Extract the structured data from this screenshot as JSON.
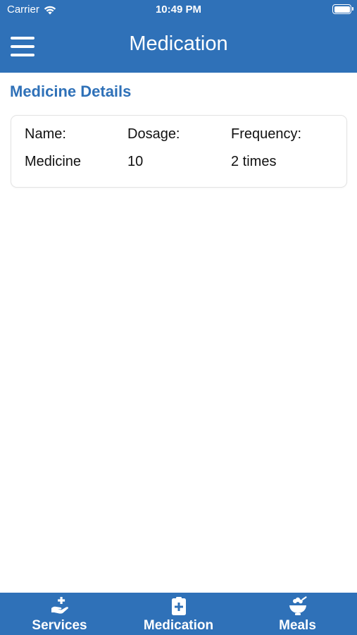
{
  "status_bar": {
    "carrier": "Carrier",
    "time": "10:49 PM"
  },
  "nav": {
    "title": "Medication",
    "menu_icon": "hamburger-menu-icon"
  },
  "section": {
    "title": "Medicine Details"
  },
  "medicine_card": {
    "columns": [
      {
        "header": "Name:",
        "value": "Medicine"
      },
      {
        "header": "Dosage:",
        "value": "10"
      },
      {
        "header": "Frequency:",
        "value": "2 times"
      }
    ]
  },
  "tab_bar": {
    "tabs": [
      {
        "label": "Services",
        "icon": "hand-holding-medical-icon"
      },
      {
        "label": "Medication",
        "icon": "notes-medical-icon"
      },
      {
        "label": "Meals",
        "icon": "food-bowl-icon"
      }
    ]
  },
  "colors": {
    "primary": "#2f71b8",
    "background": "#ffffff",
    "text": "#111111"
  }
}
